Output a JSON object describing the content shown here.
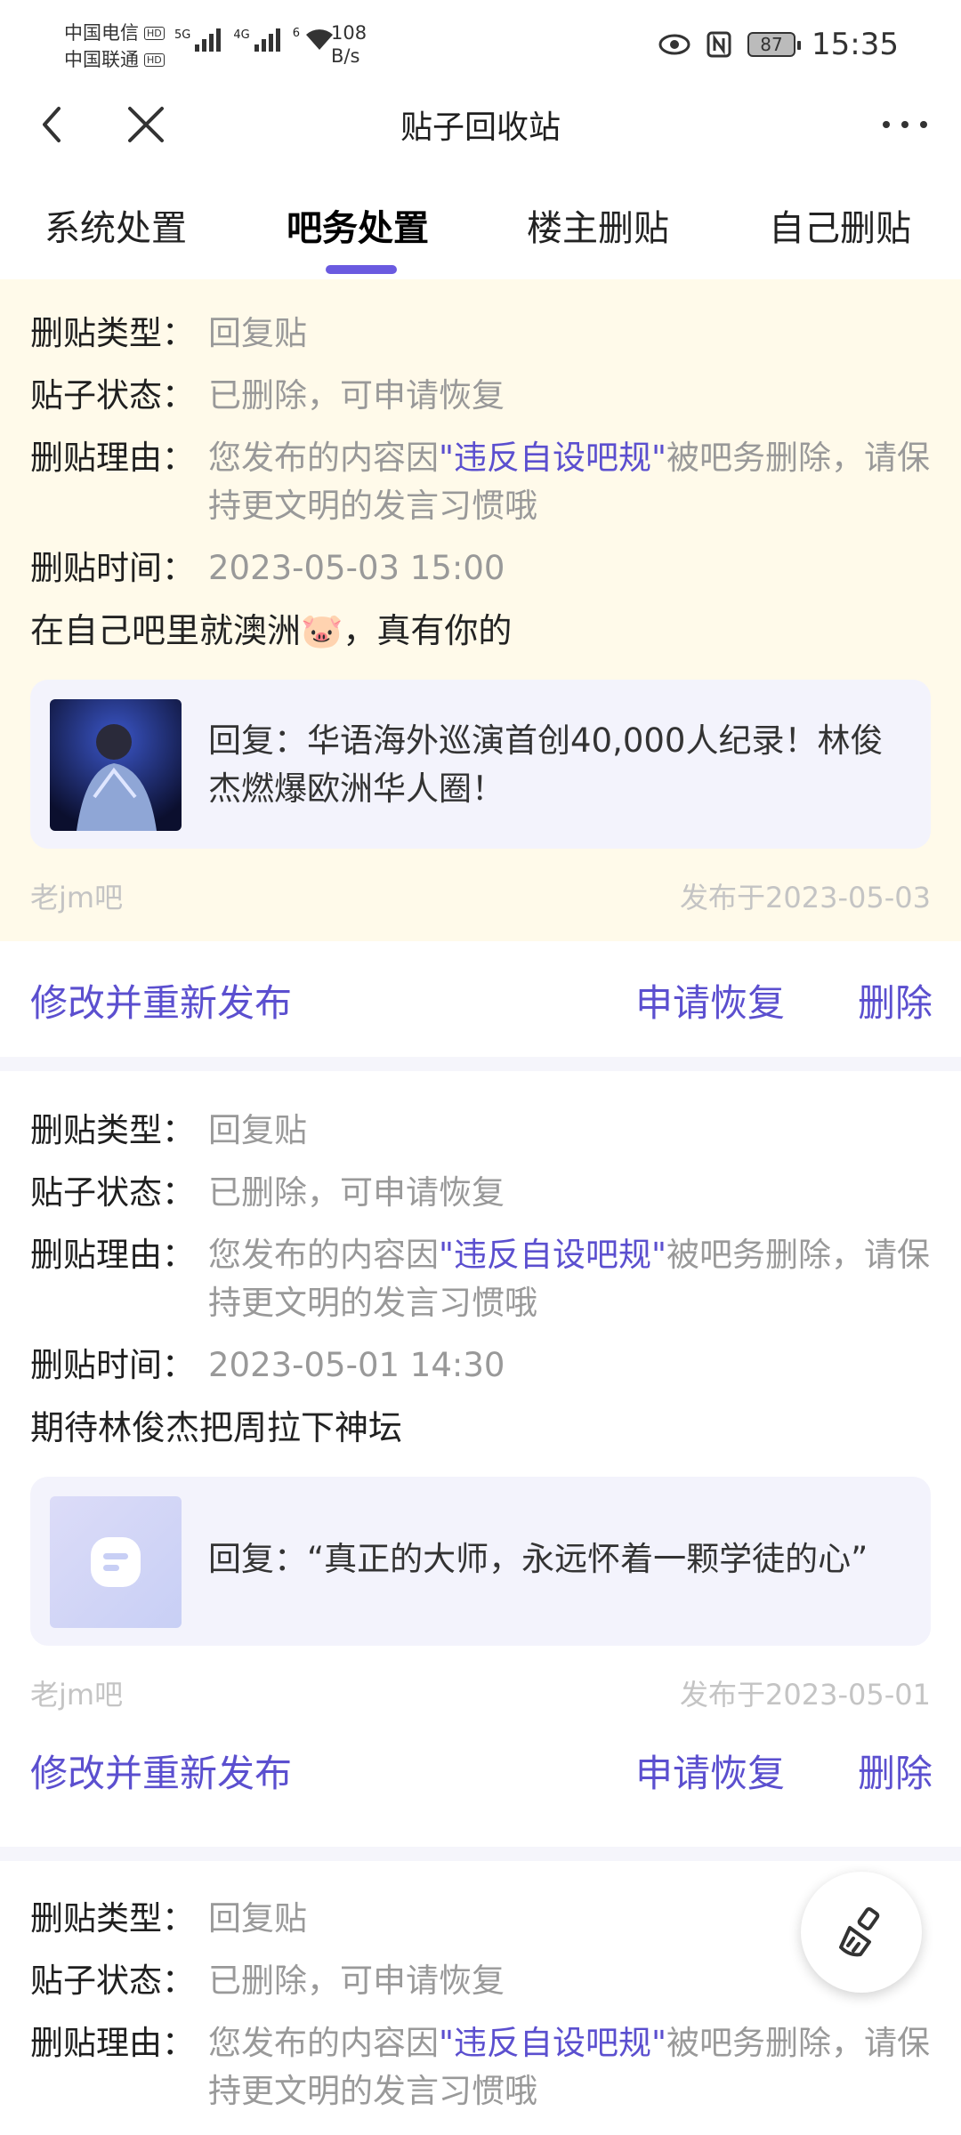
{
  "status_bar": {
    "carrier1": "中国电信",
    "carrier2": "中国联通",
    "hd": "HD",
    "net1": "5G",
    "net2": "4G",
    "wifi": "6",
    "speed_value": "108",
    "speed_unit": "B/s",
    "battery": "87",
    "time": "15:35"
  },
  "header": {
    "title": "贴子回收站"
  },
  "tabs": [
    {
      "label": "系统处置",
      "active": false
    },
    {
      "label": "吧务处置",
      "active": true
    },
    {
      "label": "楼主删贴",
      "active": false
    },
    {
      "label": "自己删贴",
      "active": false
    }
  ],
  "labels": {
    "type": "删贴类型：",
    "status": "贴子状态：",
    "reason": "删贴理由：",
    "time": "删贴时间："
  },
  "posts": [
    {
      "type": "回复贴",
      "status": "已删除，可申请恢复",
      "reason_pre": "您发布的内容因",
      "reason_hl": "\"违反自设吧规\"",
      "reason_post": "被吧务删除，请保持更文明的发言习惯哦",
      "time": "2023-05-03 15:00",
      "text": "在自己吧里就澳洲🐷，真有你的",
      "quote": "回复：华语海外巡演首创40,000人纪录！林俊杰燃爆欧洲华人圈！",
      "forum": "老jm吧",
      "published": "发布于2023-05-03"
    },
    {
      "type": "回复贴",
      "status": "已删除，可申请恢复",
      "reason_pre": "您发布的内容因",
      "reason_hl": "\"违反自设吧规\"",
      "reason_post": "被吧务删除，请保持更文明的发言习惯哦",
      "time": "2023-05-01 14:30",
      "text": "期待林俊杰把周拉下神坛",
      "quote": "回复：“真正的大师，永远怀着一颗学徒的心”",
      "forum": "老jm吧",
      "published": "发布于2023-05-01"
    },
    {
      "type": "回复贴",
      "status": "已删除，可申请恢复",
      "reason_pre": "您发布的内容因",
      "reason_hl": "\"违反自设吧规\"",
      "reason_post": "被吧务删除，请保持更文明的发言习惯哦"
    }
  ],
  "actions": {
    "edit": "修改并重新发布",
    "restore": "申请恢复",
    "delete": "删除"
  },
  "colors": {
    "accent": "#5b4fcf",
    "highlight_bg": "#fffaea",
    "quote_bg": "#f3f3fc"
  }
}
